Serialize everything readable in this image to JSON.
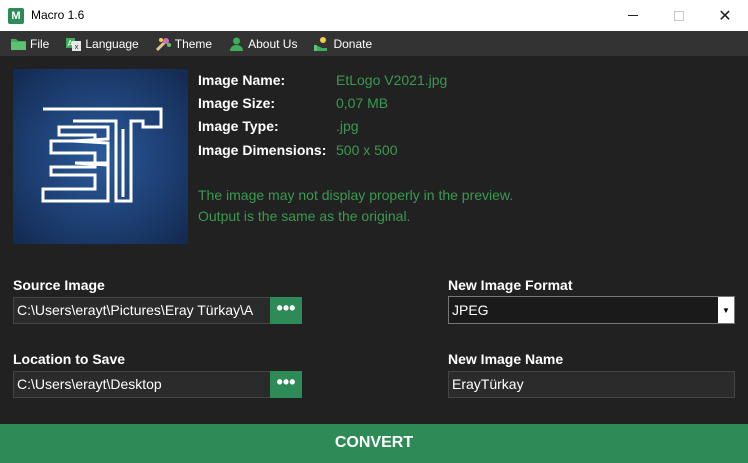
{
  "window": {
    "title": "Macro 1.6",
    "icon_glyph": "M",
    "close_glyph": "✕"
  },
  "menu": [
    {
      "label": "File",
      "icon": "folder-icon"
    },
    {
      "label": "Language",
      "icon": "language-icon"
    },
    {
      "label": "Theme",
      "icon": "palette-icon"
    },
    {
      "label": "About Us",
      "icon": "user-icon"
    },
    {
      "label": "Donate",
      "icon": "donate-icon"
    }
  ],
  "info": {
    "name_label": "Image Name:",
    "name_value": "EtLogo V2021.jpg",
    "size_label": "Image Size:",
    "size_value": "0,07 MB",
    "type_label": "Image Type:",
    "type_value": ".jpg",
    "dim_label": "Image Dimensions:",
    "dim_value": "500 x 500",
    "note_line1": "The image may not display properly in the preview.",
    "note_line2": "Output is the same as the original."
  },
  "source": {
    "label": "Source Image",
    "value": "C:\\Users\\erayt\\Pictures\\Eray Türkay\\A",
    "browse_glyph": "•••"
  },
  "location": {
    "label": "Location to Save",
    "value": "C:\\Users\\erayt\\Desktop",
    "browse_glyph": "•••"
  },
  "format": {
    "label": "New Image Format",
    "value": "JPEG",
    "arrow_glyph": "▼"
  },
  "newname": {
    "label": "New Image Name",
    "value": "ErayTürkay"
  },
  "convert_label": "CONVERT",
  "colors": {
    "accent": "#2e8b57",
    "background": "#212121",
    "menubar": "#333333",
    "info_value": "#3a9a50"
  }
}
